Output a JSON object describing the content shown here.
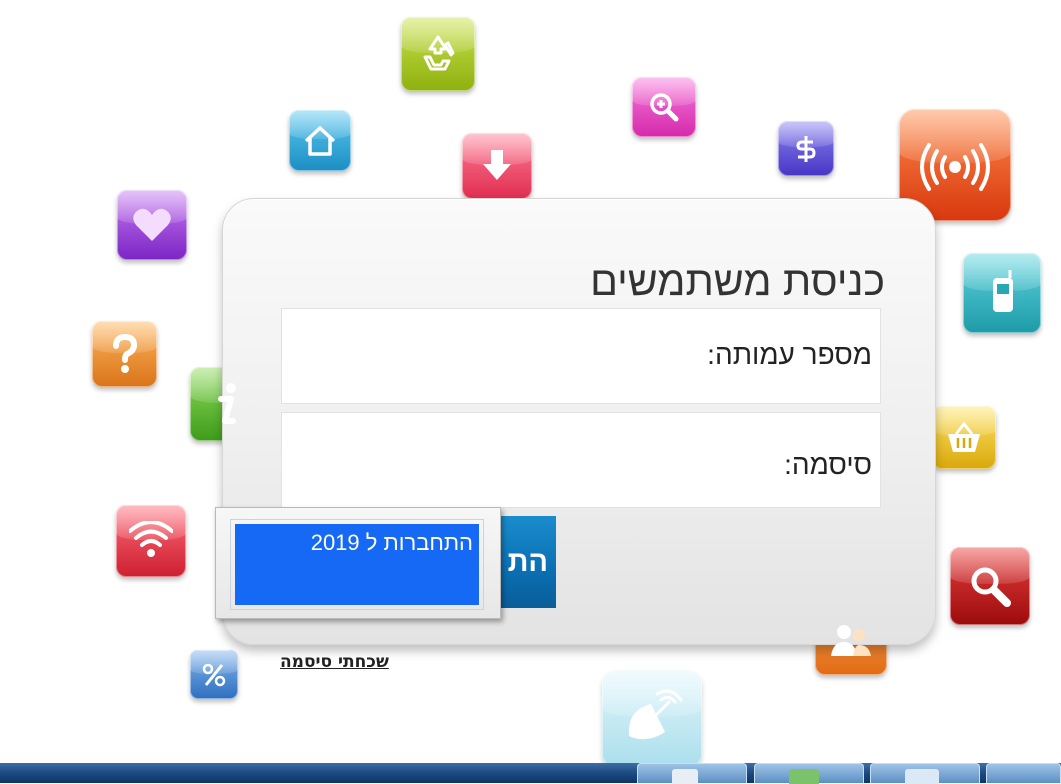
{
  "login": {
    "title": "כניסת משתמשים",
    "id_label": "מספר עמותה:",
    "password_label": "סיסמה:",
    "button_label": "הת",
    "forgot_password": "שכחתי סיסמה"
  },
  "tooltip": {
    "text": "התחברות ל 2019"
  },
  "icons": [
    {
      "name": "recycle-icon",
      "color": "#a4c418"
    },
    {
      "name": "zoom-in-icon",
      "color": "#e63dbd"
    },
    {
      "name": "home-icon",
      "color": "#2aa6d8"
    },
    {
      "name": "download-arrow-icon",
      "color": "#e8385a"
    },
    {
      "name": "dollar-sign-icon",
      "color": "#5a4fd0"
    },
    {
      "name": "broadcast-icon",
      "color": "#e14d1a"
    },
    {
      "name": "heart-icon",
      "color": "#9b3fd8"
    },
    {
      "name": "mobile-phone-icon",
      "color": "#2eb0c0"
    },
    {
      "name": "question-mark-icon",
      "color": "#e8872a"
    },
    {
      "name": "info-icon",
      "color": "#5bbd2e"
    },
    {
      "name": "shopping-basket-icon",
      "color": "#e8c11f"
    },
    {
      "name": "wifi-icon",
      "color": "#e03446"
    },
    {
      "name": "search-icon",
      "color": "#c01818"
    },
    {
      "name": "users-icon",
      "color": "#ee7d22"
    },
    {
      "name": "percent-icon",
      "color": "#3f7fcc"
    },
    {
      "name": "satellite-dish-icon",
      "color": "#9edcea"
    }
  ],
  "colors": {
    "login_button": "#0a6fb2",
    "tooltip_highlight": "#1669f4",
    "taskbar": "#1c4a82"
  }
}
